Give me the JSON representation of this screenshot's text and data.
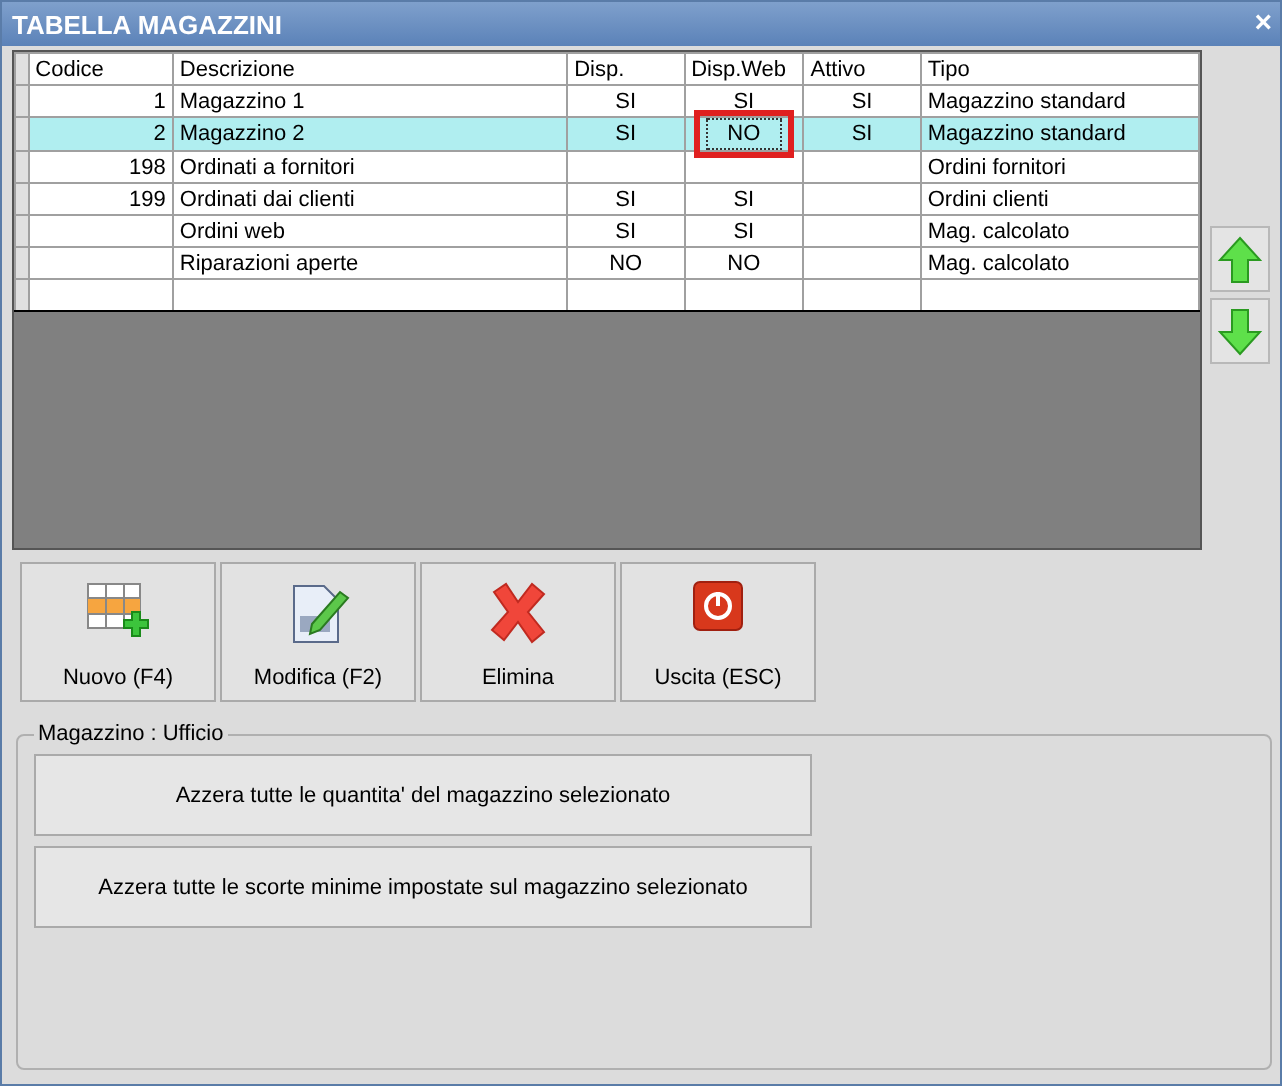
{
  "window": {
    "title": "TABELLA MAGAZZINI",
    "close": "×"
  },
  "table": {
    "columns": [
      "Codice",
      "Descrizione",
      "Disp.",
      "Disp.Web",
      "Attivo",
      "Tipo"
    ],
    "rows": [
      {
        "selected": false,
        "cells": [
          {
            "text": "1"
          },
          {
            "text": "Magazzino 1"
          },
          {
            "text": "SI"
          },
          {
            "text": "SI"
          },
          {
            "text": "SI"
          },
          {
            "text": "Magazzino standard"
          }
        ]
      },
      {
        "selected": true,
        "cells": [
          {
            "text": "2"
          },
          {
            "text": "Magazzino 2"
          },
          {
            "text": "SI"
          },
          {
            "text": "NO",
            "highlighted": true
          },
          {
            "text": "SI"
          },
          {
            "text": "Magazzino standard"
          }
        ]
      },
      {
        "selected": false,
        "cells": [
          {
            "text": "198"
          },
          {
            "text": "Ordinati a fornitori"
          },
          null,
          null,
          null,
          {
            "text": "Ordini fornitori"
          }
        ]
      },
      {
        "selected": false,
        "cells": [
          {
            "text": "199"
          },
          {
            "text": "Ordinati dai clienti"
          },
          {
            "text": "SI"
          },
          {
            "text": "SI"
          },
          null,
          {
            "text": "Ordini clienti"
          }
        ]
      },
      {
        "selected": false,
        "cells": [
          null,
          {
            "text": "Ordini web"
          },
          {
            "text": "SI"
          },
          {
            "text": "SI"
          },
          null,
          {
            "text": "Mag. calcolato"
          }
        ]
      },
      {
        "selected": false,
        "cells": [
          null,
          {
            "text": "Riparazioni aperte"
          },
          {
            "text": "NO"
          },
          {
            "text": "NO"
          },
          null,
          {
            "text": "Mag. calcolato"
          }
        ]
      }
    ]
  },
  "toolbar": [
    {
      "kind": "new",
      "label": "Nuovo (F4)"
    },
    {
      "kind": "edit",
      "label": "Modifica (F2)"
    },
    {
      "kind": "delete",
      "label": "Elimina"
    },
    {
      "kind": "exit",
      "label": "Uscita (ESC)"
    }
  ],
  "group": {
    "legend": "Magazzino : Ufficio",
    "buttons": [
      "Azzera tutte le quantita' del magazzino selezionato",
      "Azzera tutte le scorte minime impostate sul magazzino selezionato"
    ]
  }
}
